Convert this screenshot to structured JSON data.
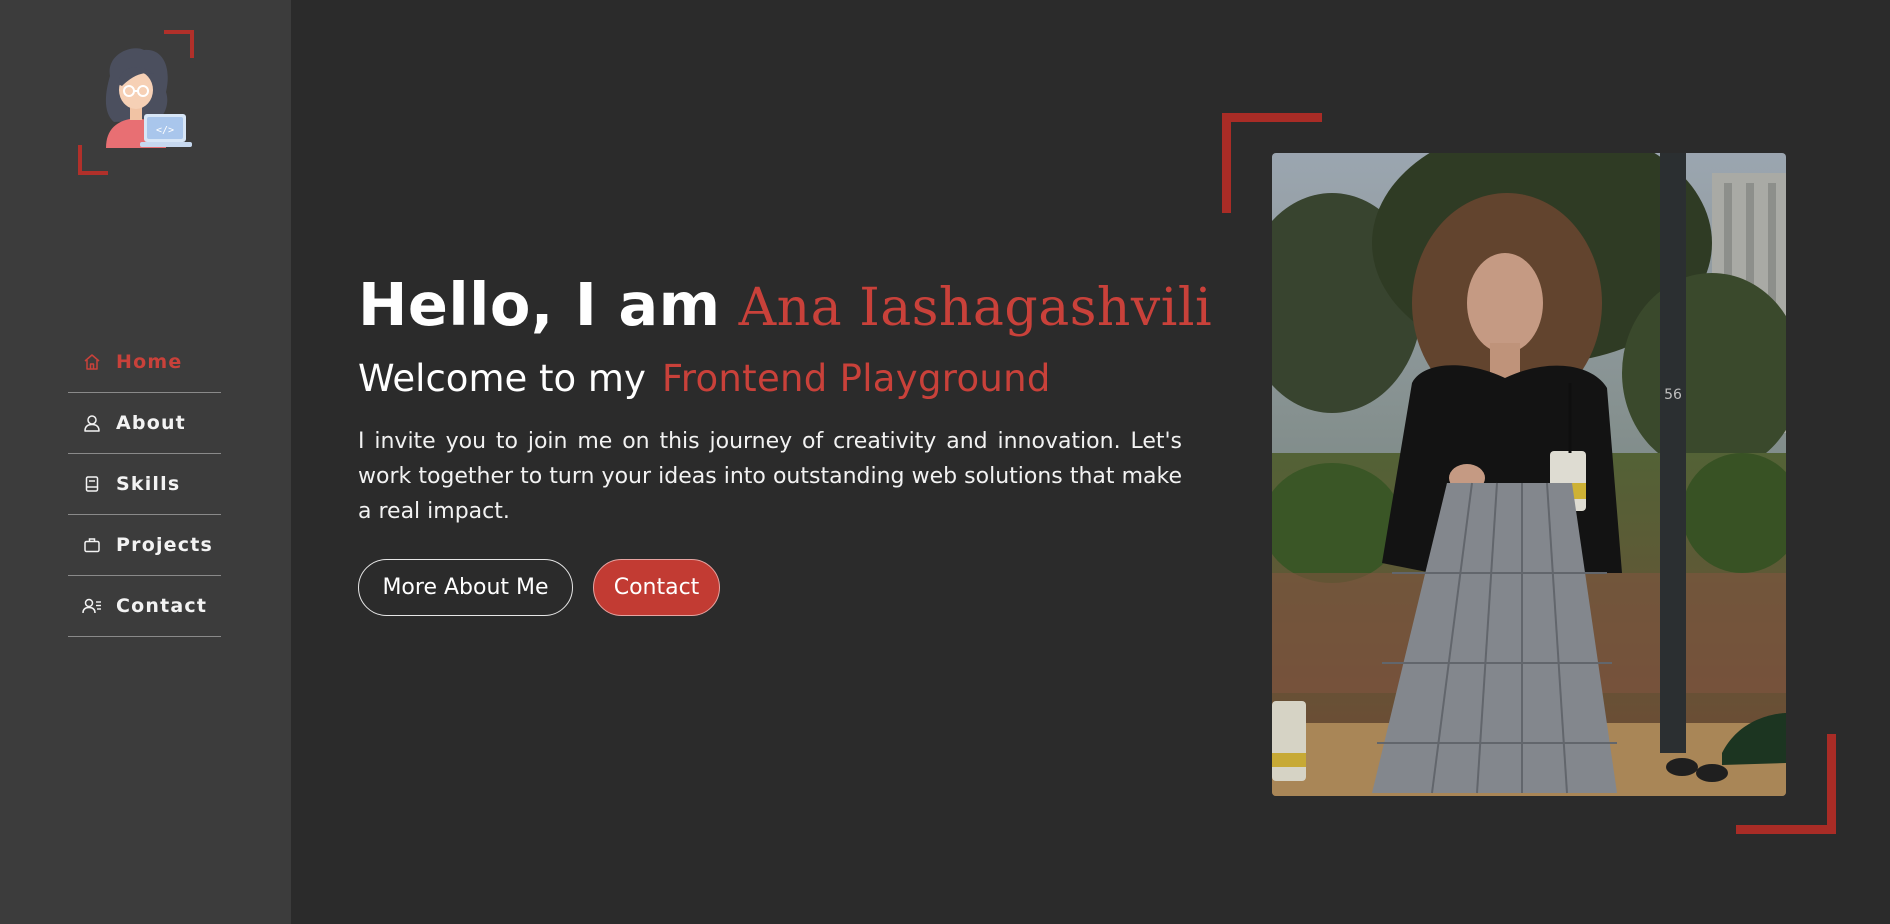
{
  "sidebar": {
    "logo_icon": "developer-avatar-icon",
    "accent": "#b1302a",
    "items": [
      {
        "label": "Home",
        "icon": "home-icon",
        "active": true
      },
      {
        "label": "About",
        "icon": "user-icon",
        "active": false
      },
      {
        "label": "Skills",
        "icon": "book-icon",
        "active": false
      },
      {
        "label": "Projects",
        "icon": "briefcase-icon",
        "active": false
      },
      {
        "label": "Contact",
        "icon": "contact-list-icon",
        "active": false
      }
    ]
  },
  "hero": {
    "greeting": "Hello, I am",
    "name": "Ana Iashagashvili",
    "welcome": "Welcome to my",
    "highlight": "Frontend Playground",
    "intro": "I invite you to join me on this journey of creativity and innovation. Let's work together to turn your ideas into outstanding web solutions that make a real impact.",
    "buttons": {
      "more": "More About Me",
      "contact": "Contact"
    }
  },
  "photo": {
    "pole_number": "56"
  },
  "colors": {
    "background": "#2b2b2b",
    "sidebar": "#3c3c3c",
    "accent": "#c9413a",
    "frame": "#a92c26"
  }
}
